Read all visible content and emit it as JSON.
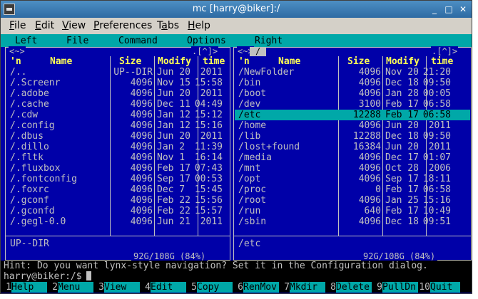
{
  "window": {
    "title": "mc [harry@biker]:/",
    "buttons": [
      "_",
      "□",
      "✕"
    ]
  },
  "menubar": {
    "items": [
      "File",
      "Edit",
      "View",
      "Preferences",
      "Tabs",
      "Help"
    ],
    "underline": [
      "F",
      "E",
      "V",
      "P",
      "a",
      "H"
    ]
  },
  "mc_menu": [
    "Left",
    "File",
    "Command",
    "Options",
    "Right"
  ],
  "panel_corner": "<~>",
  "panel_corner_right": ".[^]>",
  "headers": {
    "n": "'n",
    "name": "Name",
    "size": "Size",
    "modify": "Modify",
    "time": "time"
  },
  "left_panel": {
    "rows": [
      {
        "name": "/..",
        "size": "UP--DIR",
        "date": "Jun 20",
        "time": "2011"
      },
      {
        "name": "/.Screenr",
        "size": "4096",
        "date": "Nov 15",
        "time": "15:58"
      },
      {
        "name": "/.adobe",
        "size": "4096",
        "date": "Jun 20",
        "time": "2011"
      },
      {
        "name": "/.cache",
        "size": "4096",
        "date": "Dec 11",
        "time": "04:49"
      },
      {
        "name": "/.cdw",
        "size": "4096",
        "date": "Jan 12",
        "time": "15:12"
      },
      {
        "name": "/.config",
        "size": "4096",
        "date": "Jan 12",
        "time": "15:16"
      },
      {
        "name": "/.dbus",
        "size": "4096",
        "date": "Jun 20",
        "time": "2011"
      },
      {
        "name": "/.dillo",
        "size": "4096",
        "date": "Jan 2",
        "time": "11:39"
      },
      {
        "name": "/.fltk",
        "size": "4096",
        "date": "Nov 1",
        "time": "16:14"
      },
      {
        "name": "/.fluxbox",
        "size": "4096",
        "date": "Feb 17",
        "time": "07:43"
      },
      {
        "name": "/.fontconfig",
        "size": "4096",
        "date": "Sep 17",
        "time": "00:53"
      },
      {
        "name": "/.foxrc",
        "size": "4096",
        "date": "Dec 7",
        "time": "15:45"
      },
      {
        "name": "/.gconf",
        "size": "4096",
        "date": "Feb 22",
        "time": "15:56"
      },
      {
        "name": "/.gconfd",
        "size": "4096",
        "date": "Feb 22",
        "time": "15:57"
      },
      {
        "name": "/.gegl-0.0",
        "size": "4096",
        "date": "Jun 21",
        "time": "2011"
      }
    ],
    "status": "UP--DIR",
    "free": "92G/108G (84%)"
  },
  "right_panel": {
    "path": "/",
    "selected_index": 4,
    "rows": [
      {
        "name": "/NewFolder",
        "size": "4096",
        "date": "Nov 20",
        "time": "21:20"
      },
      {
        "name": "/bin",
        "size": "4096",
        "date": "Dec 18",
        "time": "09:50"
      },
      {
        "name": "/boot",
        "size": "4096",
        "date": "Jan 28",
        "time": "00:05"
      },
      {
        "name": "/dev",
        "size": "3100",
        "date": "Feb 17",
        "time": "06:58"
      },
      {
        "name": "/etc",
        "size": "12288",
        "date": "Feb 17",
        "time": "06:58"
      },
      {
        "name": "/home",
        "size": "4096",
        "date": "Jun 20",
        "time": "2011"
      },
      {
        "name": "/lib",
        "size": "12288",
        "date": "Dec 18",
        "time": "09:50"
      },
      {
        "name": "/lost+found",
        "size": "16384",
        "date": "Jun 20",
        "time": "2011"
      },
      {
        "name": "/media",
        "size": "4096",
        "date": "Dec 17",
        "time": "01:07"
      },
      {
        "name": "/mnt",
        "size": "4096",
        "date": "Oct 28",
        "time": "2006"
      },
      {
        "name": "/opt",
        "size": "4096",
        "date": "Sep 17",
        "time": "18:11"
      },
      {
        "name": "/proc",
        "size": "0",
        "date": "Feb 17",
        "time": "06:58"
      },
      {
        "name": "/root",
        "size": "4096",
        "date": "Jan 25",
        "time": "15:16"
      },
      {
        "name": "/run",
        "size": "640",
        "date": "Feb 17",
        "time": "10:49"
      },
      {
        "name": "/sbin",
        "size": "4096",
        "date": "Dec 18",
        "time": "09:51"
      }
    ],
    "status": "/etc",
    "free": "92G/108G (84%)"
  },
  "hint": "Hint: Do you want lynx-style navigation? Set it in the Configuration dialog.",
  "prompt": "harry@biker:/$",
  "fkeys": [
    {
      "n": "1",
      "label": "Help"
    },
    {
      "n": "2",
      "label": "Menu"
    },
    {
      "n": "3",
      "label": "View"
    },
    {
      "n": "4",
      "label": "Edit"
    },
    {
      "n": "5",
      "label": "Copy"
    },
    {
      "n": "6",
      "label": "RenMov"
    },
    {
      "n": "7",
      "label": "Mkdir"
    },
    {
      "n": "8",
      "label": "Delete"
    },
    {
      "n": "9",
      "label": "PullDn"
    },
    {
      "n": "10",
      "label": "Quit"
    }
  ],
  "colors": {
    "panel_bg": "#0000a8",
    "cyan": "#00a8a8",
    "header_yellow": "#ffff55",
    "text_grey": "#c0c0c0"
  }
}
